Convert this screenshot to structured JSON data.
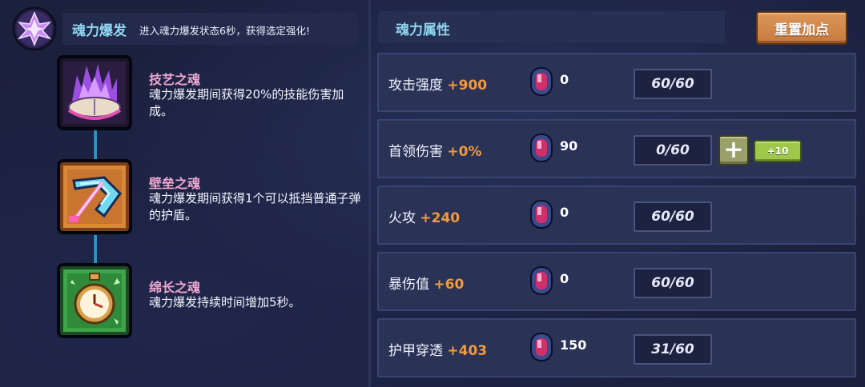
{
  "burst": {
    "title": "魂力爆发",
    "description": "进入魂力爆发状态6秒，获得选定强化!"
  },
  "souls": [
    {
      "name": "技艺之魂",
      "description": "魂力爆发期间获得20%的技能伤害加成。",
      "icon": "purple-flame-book-icon"
    },
    {
      "name": "壁垒之魂",
      "description": "魂力爆发期间获得1个可以抵挡普通子弹的护盾。",
      "icon": "shield-sword-icon"
    },
    {
      "name": "绵长之魂",
      "description": "魂力爆发持续时间增加5秒。",
      "icon": "stopwatch-icon"
    }
  ],
  "attributes": {
    "header": "魂力属性",
    "reset_label": "重置加点",
    "stats": [
      {
        "label": "攻击强度",
        "bonus": "+900",
        "gems": "0",
        "level": "60/60"
      },
      {
        "label": "首领伤害",
        "bonus": "+0%",
        "gems": "90",
        "level": "0/60",
        "plus_label": "+",
        "plus10_label": "+10"
      },
      {
        "label": "火攻",
        "bonus": "+240",
        "gems": "0",
        "level": "60/60"
      },
      {
        "label": "暴伤值",
        "bonus": "+60",
        "gems": "0",
        "level": "60/60"
      },
      {
        "label": "护甲穿透",
        "bonus": "+403",
        "gems": "150",
        "level": "31/60"
      }
    ]
  },
  "colors": {
    "accent_cyan": "#8fd6f0",
    "bonus_orange": "#f29a3c",
    "soul_name_pink": "#f0a8d0",
    "reset_button": "#d38b4f",
    "plus_button": "#9aa06a",
    "plus10_button": "#9fc84a"
  }
}
